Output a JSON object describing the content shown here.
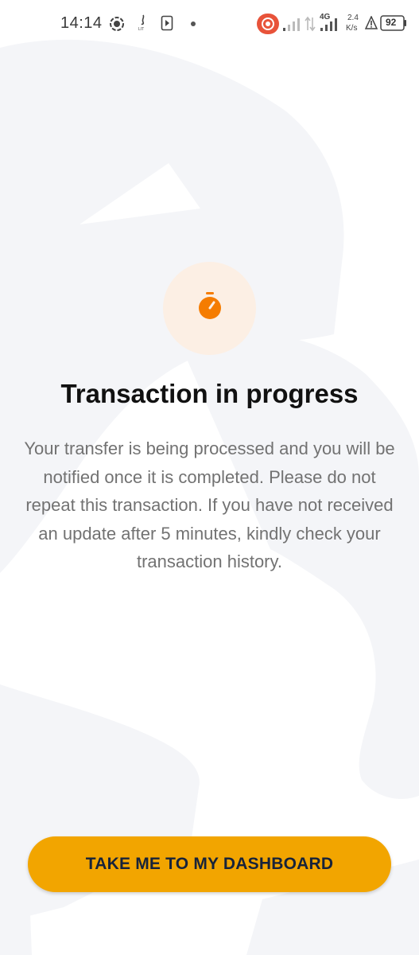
{
  "status_bar": {
    "time": "14:14",
    "network_type": "4G",
    "speed_value": "2.4",
    "speed_unit": "K/s",
    "battery_level": "92",
    "icons": [
      "screen-record-icon",
      "lite-app-icon",
      "media-icon",
      "dot-icon",
      "recording-indicator-icon",
      "signal-1-icon",
      "data-arrows-icon",
      "signal-2-icon",
      "alert-icon",
      "battery-icon"
    ]
  },
  "status_icon": {
    "name": "stopwatch-icon",
    "color": "#f57c00",
    "background": "#fcefe4"
  },
  "title": "Transaction in progress",
  "message": "Your transfer is being processed and you will be notified once it is completed. Please do not repeat this transaction. If you have not received an update after 5 minutes, kindly check your transaction history.",
  "primary_button": {
    "label": "TAKE ME TO MY DASHBOARD",
    "color": "#f2a500"
  }
}
